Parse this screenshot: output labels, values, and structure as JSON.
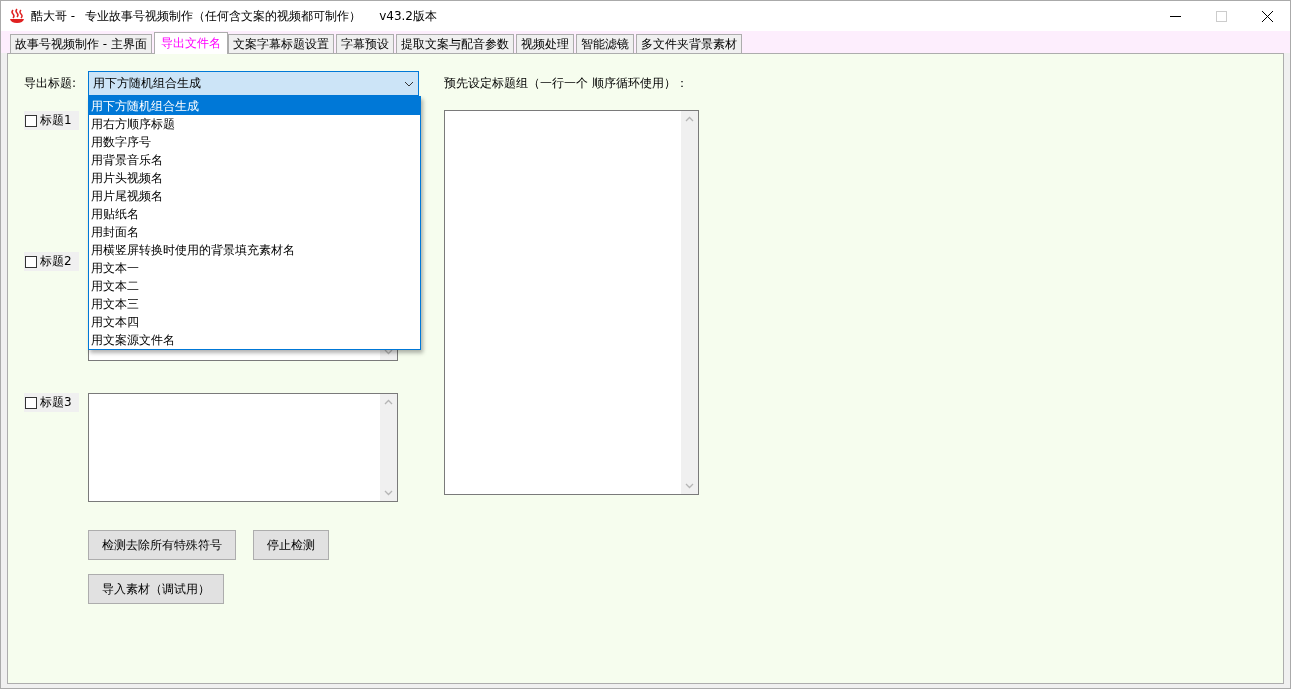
{
  "window": {
    "app_name": "酷大哥 -",
    "subtitle": "专业故事号视频制作（任何含文案的视频都可制作）",
    "version": "v43.2版本"
  },
  "tabs": [
    {
      "label": "故事号视频制作 - 主界面",
      "selected": false
    },
    {
      "label": "导出文件名",
      "selected": true
    },
    {
      "label": "文案字幕标题设置",
      "selected": false
    },
    {
      "label": "字幕预设",
      "selected": false
    },
    {
      "label": "提取文案与配音参数",
      "selected": false
    },
    {
      "label": "视频处理",
      "selected": false
    },
    {
      "label": "智能滤镜",
      "selected": false
    },
    {
      "label": "多文件夹背景素材",
      "selected": false
    }
  ],
  "export_title": {
    "label": "导出标题:",
    "value": "用下方随机组合生成",
    "expanded": true,
    "options": [
      {
        "label": "用下方随机组合生成",
        "selected": true
      },
      {
        "label": "用右方顺序标题",
        "selected": false
      },
      {
        "label": "用数字序号",
        "selected": false
      },
      {
        "label": "用背景音乐名",
        "selected": false
      },
      {
        "label": "用片头视频名",
        "selected": false
      },
      {
        "label": "用片尾视频名",
        "selected": false
      },
      {
        "label": "用贴纸名",
        "selected": false
      },
      {
        "label": "用封面名",
        "selected": false
      },
      {
        "label": "用横竖屏转换时使用的背景填充素材名",
        "selected": false
      },
      {
        "label": "用文本一",
        "selected": false
      },
      {
        "label": "用文本二",
        "selected": false
      },
      {
        "label": "用文本三",
        "selected": false
      },
      {
        "label": "用文本四",
        "selected": false
      },
      {
        "label": "用文案源文件名",
        "selected": false
      }
    ]
  },
  "titles": [
    {
      "label": "标题1",
      "checked": false
    },
    {
      "label": "标题2",
      "checked": false
    },
    {
      "label": "标题3",
      "checked": false
    }
  ],
  "preset": {
    "label": "预先设定标题组（一行一个 顺序循环使用）："
  },
  "buttons": [
    {
      "label": "检测去除所有特殊符号"
    },
    {
      "label": "停止检测"
    },
    {
      "label": "导入素材（调试用）"
    }
  ]
}
